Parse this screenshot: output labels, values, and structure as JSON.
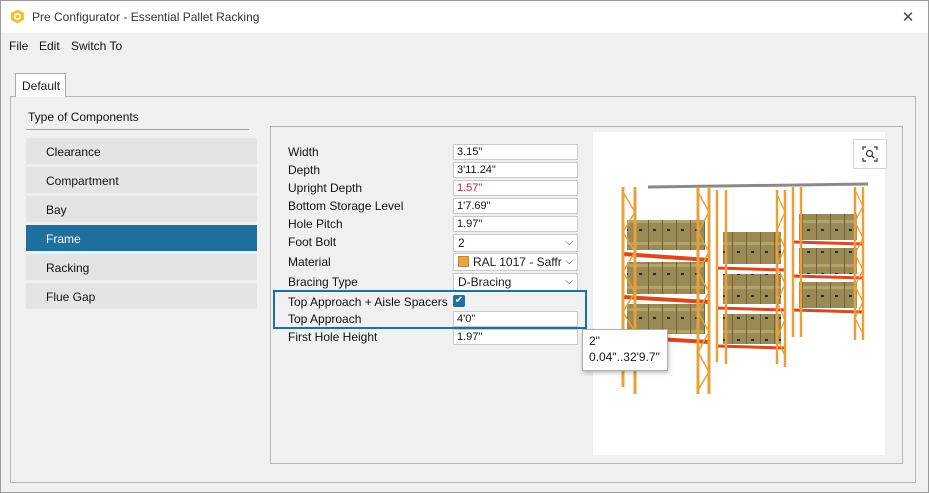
{
  "window": {
    "title": "Pre Configurator - Essential Pallet Racking",
    "close_symbol": "✕"
  },
  "menu": {
    "items": [
      "File",
      "Edit",
      "Switch To"
    ]
  },
  "tabs": {
    "active": "Default"
  },
  "components": {
    "heading": "Type of Components",
    "items": [
      "Clearance",
      "Compartment",
      "Bay",
      "Frame",
      "Racking",
      "Flue Gap"
    ],
    "selected": "Frame"
  },
  "properties": {
    "width": {
      "label": "Width",
      "value": "3.15\""
    },
    "depth": {
      "label": "Depth",
      "value": "3'11.24\""
    },
    "upright_depth": {
      "label": "Upright Depth",
      "value": "1.57\""
    },
    "bottom_storage_level": {
      "label": "Bottom Storage Level",
      "value": "1'7.69\""
    },
    "hole_pitch": {
      "label": "Hole Pitch",
      "value": "1.97\""
    },
    "foot_bolt": {
      "label": "Foot Bolt",
      "value": "2"
    },
    "material": {
      "label": "Material",
      "value": "RAL 1017 - Saffr"
    },
    "bracing_type": {
      "label": "Bracing Type",
      "value": "D-Bracing"
    },
    "top_approach_aisle_spacers": {
      "label": "Top Approach + Aisle Spacers",
      "checked": true
    },
    "top_approach": {
      "label": "Top Approach",
      "value": "4'0\""
    },
    "first_hole_height": {
      "label": "First Hole Height",
      "value": "1.97\""
    }
  },
  "tooltip": {
    "line1": "2\"",
    "line2": "0.04\"..32'9.7\""
  },
  "colors": {
    "accent": "#1f6f9f",
    "upright_error": "#c4173b",
    "rack_upright": "#e8a03a",
    "rack_beam": "#d9481e",
    "box": "#9a8a55",
    "material_swatch": "#e8a448"
  }
}
